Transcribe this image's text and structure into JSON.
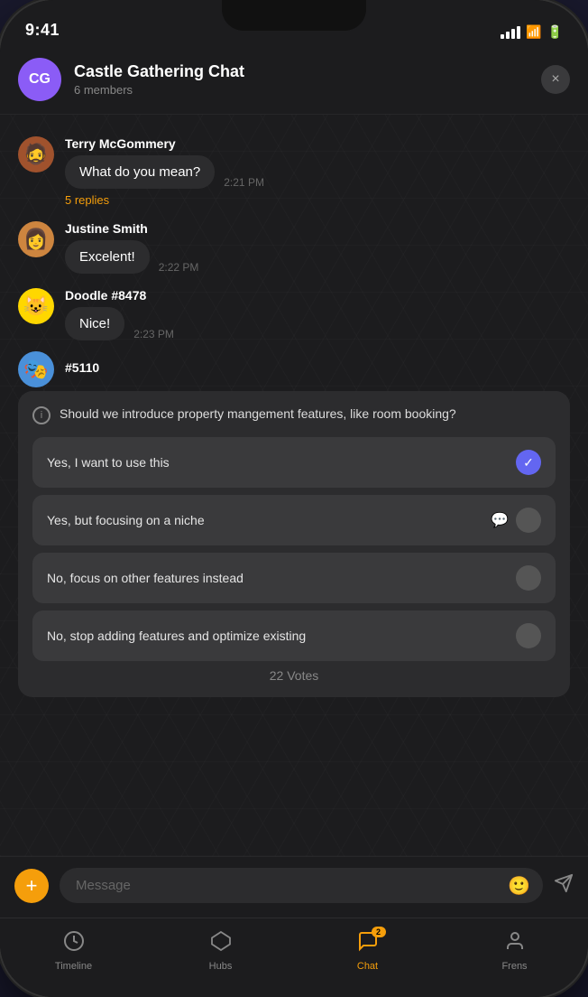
{
  "status_bar": {
    "time": "9:41"
  },
  "header": {
    "avatar_initials": "CG",
    "title": "Castle Gathering Chat",
    "subtitle": "6 members",
    "close_label": "×"
  },
  "messages": [
    {
      "id": "msg1",
      "user": "Terry McGommery",
      "bubble": "What do you mean?",
      "time": "2:21 PM",
      "replies": "5 replies",
      "avatar_emoji": "🧔"
    },
    {
      "id": "msg2",
      "user": "Justine Smith",
      "bubble": "Excelent!",
      "time": "2:22 PM",
      "replies": null,
      "avatar_emoji": "👩"
    },
    {
      "id": "msg3",
      "user": "Doodle #8478",
      "bubble": "Nice!",
      "time": "2:23 PM",
      "replies": null,
      "avatar_emoji": "🐱"
    }
  ],
  "partial_user": {
    "name": "#5110",
    "avatar_emoji": "🎭"
  },
  "poll": {
    "question": "Should we introduce property mangement features, like room booking?",
    "info_symbol": "i",
    "options": [
      {
        "text": "Yes, I want to use this",
        "state": "checked"
      },
      {
        "text": "Yes, but focusing on a niche",
        "state": "comment"
      },
      {
        "text": "No, focus on other features instead",
        "state": "empty"
      },
      {
        "text": "No, stop adding features and optimize existing",
        "state": "empty"
      }
    ],
    "votes_label": "22 Votes"
  },
  "input": {
    "placeholder": "Message"
  },
  "bottom_nav": [
    {
      "id": "timeline",
      "label": "Timeline",
      "icon": "🕐",
      "active": false
    },
    {
      "id": "hubs",
      "label": "Hubs",
      "icon": "⬡",
      "active": false
    },
    {
      "id": "chat",
      "label": "Chat",
      "icon": "💬",
      "active": true,
      "badge": "2"
    },
    {
      "id": "frens",
      "label": "Frens",
      "icon": "👤",
      "active": false
    }
  ]
}
